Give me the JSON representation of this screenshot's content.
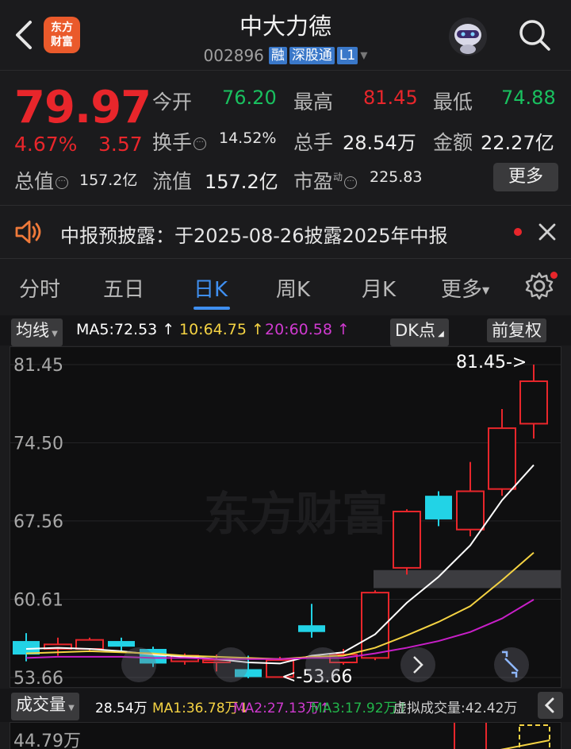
{
  "header": {
    "title": "中大力德",
    "code": "002896",
    "badges": [
      "融",
      "深股通",
      "L1"
    ],
    "logo_line1": "东方",
    "logo_line2": "财富"
  },
  "quote": {
    "price": "79.97",
    "change_pct": "4.67%",
    "change_abs": "3.57",
    "open_label": "今开",
    "open": "76.20",
    "high_label": "最高",
    "high": "81.45",
    "low_label": "最低",
    "low": "74.88",
    "turnover_label": "换手",
    "turnover": "14.52%",
    "volume_label": "总手",
    "volume": "28.54万",
    "amount_label": "金额",
    "amount": "22.27亿",
    "mcap_label": "总值",
    "mcap": "157.2亿",
    "float_label": "流值",
    "float": "157.2亿",
    "pe_label": "市盈",
    "pe_sup": "动",
    "pe": "225.83",
    "more": "更多"
  },
  "notice": {
    "text": "中报预披露：于2025-08-26披露2025年中报"
  },
  "tabs": [
    "分时",
    "五日",
    "日K",
    "周K",
    "月K",
    "更多"
  ],
  "indicator": {
    "select": "均线",
    "ma5": "MA5:72.53",
    "ma10": "10:64.75",
    "ma20": "20:60.58",
    "dk": "DK点",
    "adjust": "前复权"
  },
  "colors": {
    "up": "#e8262b",
    "down": "#22d3e6",
    "ma5": "#ffffff",
    "ma10": "#f5d343",
    "ma20": "#c81fc8",
    "accent": "#3f8ff0"
  },
  "chart_data": {
    "type": "candlestick",
    "y_ticks": [
      "81.45",
      "74.50",
      "67.56",
      "60.61",
      "53.66"
    ],
    "ylim": [
      53.66,
      81.45
    ],
    "high_marker": "81.45->",
    "low_marker": "<-53.66",
    "watermark": "东方财富",
    "candles": [
      {
        "o": 56.9,
        "c": 55.7,
        "h": 57.6,
        "l": 55.1
      },
      {
        "o": 56.2,
        "c": 56.6,
        "h": 57.2,
        "l": 55.6
      },
      {
        "o": 56.2,
        "c": 57.0,
        "h": 57.2,
        "l": 56.0
      },
      {
        "o": 56.9,
        "c": 56.4,
        "h": 57.2,
        "l": 55.9
      },
      {
        "o": 56.2,
        "c": 54.9,
        "h": 56.4,
        "l": 54.6
      },
      {
        "o": 55.1,
        "c": 55.6,
        "h": 55.8,
        "l": 54.8
      },
      {
        "o": 55.0,
        "c": 55.2,
        "h": 55.7,
        "l": 54.2
      },
      {
        "o": 54.4,
        "c": 53.7,
        "h": 55.6,
        "l": 53.6
      },
      {
        "o": 53.7,
        "c": 55.2,
        "h": 55.5,
        "l": 53.66
      },
      {
        "o": 58.3,
        "c": 57.7,
        "h": 60.2,
        "l": 57.2
      },
      {
        "o": 55.0,
        "c": 55.7,
        "h": 56.2,
        "l": 54.8
      },
      {
        "o": 55.4,
        "c": 61.2,
        "h": 61.4,
        "l": 55.2
      },
      {
        "o": 63.4,
        "c": 68.4,
        "h": 68.6,
        "l": 62.8
      },
      {
        "o": 69.8,
        "c": 67.7,
        "h": 70.2,
        "l": 67.1
      },
      {
        "o": 66.8,
        "c": 70.2,
        "h": 72.8,
        "l": 66.2
      },
      {
        "o": 70.4,
        "c": 75.8,
        "h": 77.5,
        "l": 69.8
      },
      {
        "o": 76.2,
        "c": 79.97,
        "h": 81.45,
        "l": 74.88
      }
    ],
    "ma5": [
      56.2,
      56.3,
      56.2,
      56.0,
      55.7,
      55.5,
      55.3,
      55.0,
      54.9,
      55.6,
      55.9,
      57.5,
      60.3,
      62.6,
      65.4,
      69.4,
      72.53
    ],
    "ma10": [
      55.8,
      55.9,
      56.0,
      55.9,
      55.8,
      55.6,
      55.5,
      55.4,
      55.3,
      55.5,
      55.6,
      56.3,
      57.4,
      58.6,
      60.0,
      62.3,
      64.75
    ],
    "ma20": [
      55.4,
      55.5,
      55.5,
      55.5,
      55.4,
      55.4,
      55.3,
      55.3,
      55.3,
      55.4,
      55.4,
      55.8,
      56.3,
      56.9,
      57.7,
      58.9,
      60.58
    ]
  },
  "volume_bar": {
    "select": "成交量",
    "vol": "28.54万",
    "ma1": "MA1:36.78万",
    "ma2": "MA2:27.13万",
    "ma3": "MA3:17.92万",
    "virtual": "虚拟成交量:42.42万",
    "top_tick": "44.79万"
  }
}
